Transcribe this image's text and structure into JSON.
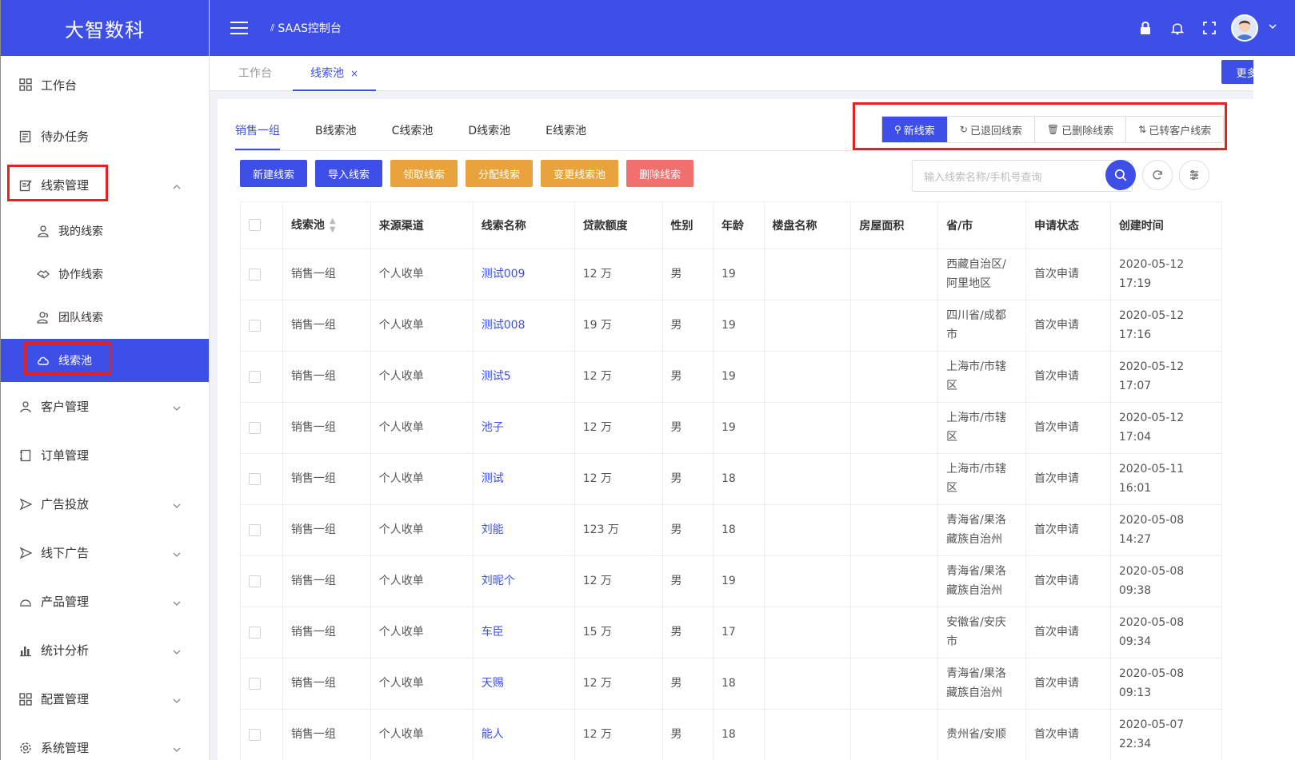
{
  "brand": "大智数科",
  "header": {
    "console_title": "SAAS控制台"
  },
  "sidebar": {
    "items": [
      {
        "label": "工作台"
      },
      {
        "label": "待办任务"
      },
      {
        "label": "线索管理"
      },
      {
        "label": "我的线索"
      },
      {
        "label": "协作线索"
      },
      {
        "label": "团队线索"
      },
      {
        "label": "线索池"
      },
      {
        "label": "客户管理"
      },
      {
        "label": "订单管理"
      },
      {
        "label": "广告投放"
      },
      {
        "label": "线下广告"
      },
      {
        "label": "产品管理"
      },
      {
        "label": "统计分析"
      },
      {
        "label": "配置管理"
      },
      {
        "label": "系统管理"
      }
    ]
  },
  "tabs": {
    "workbench": "工作台",
    "pool": "线索池",
    "close": "×",
    "more": "更多"
  },
  "subtabs": [
    "销售一组",
    "B线索池",
    "C线索池",
    "D线索池",
    "E线索池"
  ],
  "views": [
    "新线索",
    "已退回线索",
    "已删除线索",
    "已转客户线索"
  ],
  "actions": [
    "新建线索",
    "导入线索",
    "领取线索",
    "分配线索",
    "变更线索池",
    "删除线索"
  ],
  "search": {
    "placeholder": "输入线索名称/手机号查询"
  },
  "table": {
    "headers": [
      "线索池",
      "来源渠道",
      "线索名称",
      "贷款额度",
      "性别",
      "年龄",
      "楼盘名称",
      "房屋面积",
      "省/市",
      "申请状态",
      "创建时间"
    ],
    "rows": [
      {
        "pool": "销售一组",
        "source": "个人收单",
        "name": "测试009",
        "amount": "12 万",
        "gender": "男",
        "age": "19",
        "estate": "",
        "area": "",
        "region1": "西藏自治区/",
        "region2": "阿里地区",
        "status": "首次申请",
        "created": "2020-05-12 17:19"
      },
      {
        "pool": "销售一组",
        "source": "个人收单",
        "name": "测试008",
        "amount": "19 万",
        "gender": "男",
        "age": "19",
        "estate": "",
        "area": "",
        "region1": "四川省/成都",
        "region2": "市",
        "status": "首次申请",
        "created": "2020-05-12 17:16"
      },
      {
        "pool": "销售一组",
        "source": "个人收单",
        "name": "测试5",
        "amount": "12 万",
        "gender": "男",
        "age": "19",
        "estate": "",
        "area": "",
        "region1": "上海市/市辖",
        "region2": "区",
        "status": "首次申请",
        "created": "2020-05-12 17:07"
      },
      {
        "pool": "销售一组",
        "source": "个人收单",
        "name": "池子",
        "amount": "12 万",
        "gender": "男",
        "age": "19",
        "estate": "",
        "area": "",
        "region1": "上海市/市辖",
        "region2": "区",
        "status": "首次申请",
        "created": "2020-05-12 17:04"
      },
      {
        "pool": "销售一组",
        "source": "个人收单",
        "name": "测试",
        "amount": "12 万",
        "gender": "男",
        "age": "18",
        "estate": "",
        "area": "",
        "region1": "上海市/市辖",
        "region2": "区",
        "status": "首次申请",
        "created": "2020-05-11 16:01"
      },
      {
        "pool": "销售一组",
        "source": "个人收单",
        "name": "刘能",
        "amount": "123 万",
        "gender": "男",
        "age": "18",
        "estate": "",
        "area": "",
        "region1": "青海省/果洛",
        "region2": "藏族自治州",
        "status": "首次申请",
        "created": "2020-05-08 14:27"
      },
      {
        "pool": "销售一组",
        "source": "个人收单",
        "name": "刘昵个",
        "amount": "12 万",
        "gender": "男",
        "age": "19",
        "estate": "",
        "area": "",
        "region1": "青海省/果洛",
        "region2": "藏族自治州",
        "status": "首次申请",
        "created": "2020-05-08 09:38"
      },
      {
        "pool": "销售一组",
        "source": "个人收单",
        "name": "车臣",
        "amount": "15 万",
        "gender": "男",
        "age": "17",
        "estate": "",
        "area": "",
        "region1": "安徽省/安庆",
        "region2": "市",
        "status": "首次申请",
        "created": "2020-05-08 09:34"
      },
      {
        "pool": "销售一组",
        "source": "个人收单",
        "name": "天赐",
        "amount": "12 万",
        "gender": "男",
        "age": "18",
        "estate": "",
        "area": "",
        "region1": "青海省/果洛",
        "region2": "藏族自治州",
        "status": "首次申请",
        "created": "2020-05-08 09:13"
      },
      {
        "pool": "销售一组",
        "source": "个人收单",
        "name": "能人",
        "amount": "12 万",
        "gender": "男",
        "age": "18",
        "estate": "",
        "area": "",
        "region1": "贵州省/安顺",
        "region2": "",
        "status": "首次申请",
        "created": "2020-05-07 22:34"
      }
    ]
  },
  "colors": {
    "primary": "#3d4fe6",
    "orange": "#e8a33c",
    "red": "#f07070",
    "highlight": "#e82020"
  }
}
